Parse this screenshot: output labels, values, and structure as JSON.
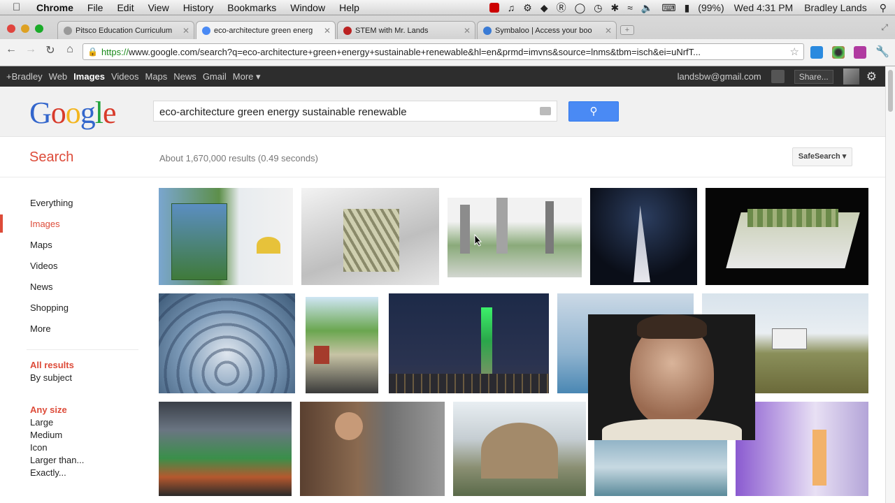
{
  "menubar": {
    "app": "Chrome",
    "items": [
      "File",
      "Edit",
      "View",
      "History",
      "Bookmarks",
      "Window",
      "Help"
    ],
    "battery": "(99%)",
    "clock": "Wed 4:31 PM",
    "user": "Bradley Lands"
  },
  "tabs": [
    {
      "title": "Pitsco Education Curriculum",
      "active": false
    },
    {
      "title": "eco-architecture green energ",
      "active": true
    },
    {
      "title": "STEM with Mr. Lands",
      "active": false
    },
    {
      "title": "Symbaloo | Access your boo",
      "active": false
    }
  ],
  "omnibox": {
    "scheme": "https://",
    "url": "www.google.com/search?q=eco-architecture+green+energy+sustainable+renewable&hl=en&prmd=imvns&source=lnms&tbm=isch&ei=uNrfT..."
  },
  "gbar": {
    "items": [
      "+Bradley",
      "Web",
      "Images",
      "Videos",
      "Maps",
      "News",
      "Gmail",
      "More ▾"
    ],
    "email": "landsbw@gmail.com",
    "share": "Share..."
  },
  "search": {
    "query": "eco-architecture green energy sustainable renewable",
    "label": "Search",
    "stats": "About 1,670,000 results (0.49 seconds)",
    "safesearch": "SafeSearch ▾"
  },
  "leftnav": {
    "types": [
      "Everything",
      "Images",
      "Maps",
      "Videos",
      "News",
      "Shopping",
      "More"
    ],
    "results": [
      "All results",
      "By subject"
    ],
    "size_title": "Any size",
    "sizes": [
      "Large",
      "Medium",
      "Icon",
      "Larger than...",
      "Exactly..."
    ]
  },
  "colors": {
    "accent": "#dd4b39",
    "search_button": "#4a8af4",
    "gbar": "#2d2d2d"
  }
}
